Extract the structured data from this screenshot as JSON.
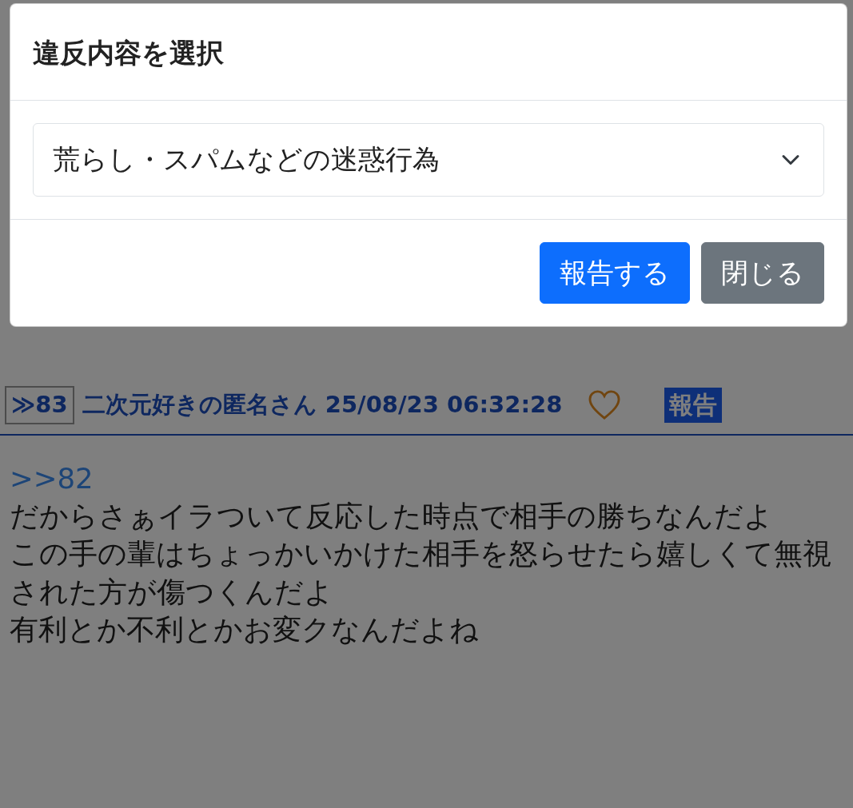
{
  "modal": {
    "title": "違反内容を選択",
    "select": {
      "value": "荒らし・スパムなどの迷惑行為"
    },
    "buttons": [
      {
        "label": "報告する",
        "kind": "primary"
      },
      {
        "label": "閉じる",
        "kind": "secondary"
      }
    ]
  },
  "post": {
    "number": "≫83",
    "author": "二次元好きの匿名さん",
    "timestamp": "25/08/23 06:32:28",
    "liked": false,
    "report": "報告",
    "reply_to": ">>82",
    "lines": [
      "だからさぁイラついて反応した時点で相手の勝ちなんだよ",
      "この手の輩はちょっかいかけた相手を怒らせたら嬉しくて無視された方が傷つくんだよ",
      "有利とか不利とかお変クなんだよね"
    ]
  }
}
